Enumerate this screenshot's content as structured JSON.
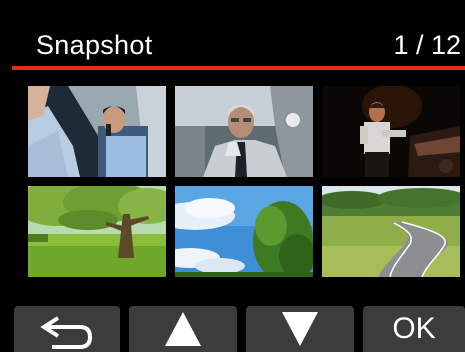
{
  "header": {
    "title": "Snapshot",
    "counter": "1 / 12"
  },
  "colors": {
    "accent_rule": "#e32b1e",
    "button_bg": "#3c3c3c",
    "background": "#000000"
  },
  "thumbnails": [
    {
      "subject": "man-on-phone-in-car"
    },
    {
      "subject": "older-man-in-car-backseat"
    },
    {
      "subject": "police-officer-at-night"
    },
    {
      "subject": "tree-in-green-field"
    },
    {
      "subject": "blue-sky-with-clouds-and-tree"
    },
    {
      "subject": "country-road-through-hills"
    }
  ],
  "softkeys": {
    "back_icon": "return-arrow-icon",
    "up_icon": "triangle-up-icon",
    "down_icon": "triangle-down-icon",
    "ok_label": "OK"
  }
}
